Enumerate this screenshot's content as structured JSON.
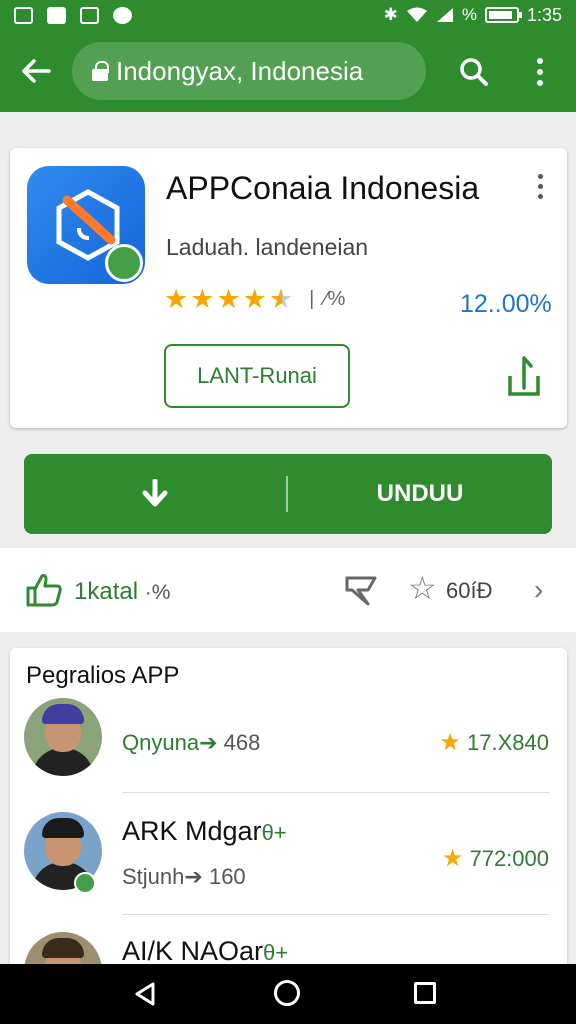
{
  "status_bar": {
    "battery_level": 0.9,
    "signal_text": "%",
    "time": "1:35"
  },
  "app_bar": {
    "url": "Indongyax, Indonesia"
  },
  "app_card": {
    "title": "APPConaia Indonesia",
    "developer": "Laduah. landeneian",
    "rating_stars": 4.5,
    "rating_sep": "|",
    "rating_count": "⁄%",
    "install_percent": "12..00%",
    "secondary_button": "LANT-Runai"
  },
  "download": {
    "label": "UNDUU"
  },
  "actions": {
    "like_label": "1katal",
    "like_suffix": "·%",
    "star_count": "60íÐ"
  },
  "list": {
    "heading": "Pegralios APP",
    "rows": [
      {
        "name": "",
        "sub_green": "Qnyuna",
        "sub_arrow": "➔",
        "sub_num": "468",
        "rating": "17.X840"
      },
      {
        "name": "ARK Mdgar",
        "name_plus": "θ+",
        "sub_green": "",
        "sub_plain": "Stjunh",
        "sub_arrow": "➔",
        "sub_num": "160",
        "rating": "772:000"
      },
      {
        "name": "AI/K NAOar",
        "name_plus": "θ+"
      }
    ]
  },
  "colors": {
    "primary_green": "#2e8b2e",
    "star_yellow": "#f6a800",
    "link_blue": "#1976d2"
  }
}
